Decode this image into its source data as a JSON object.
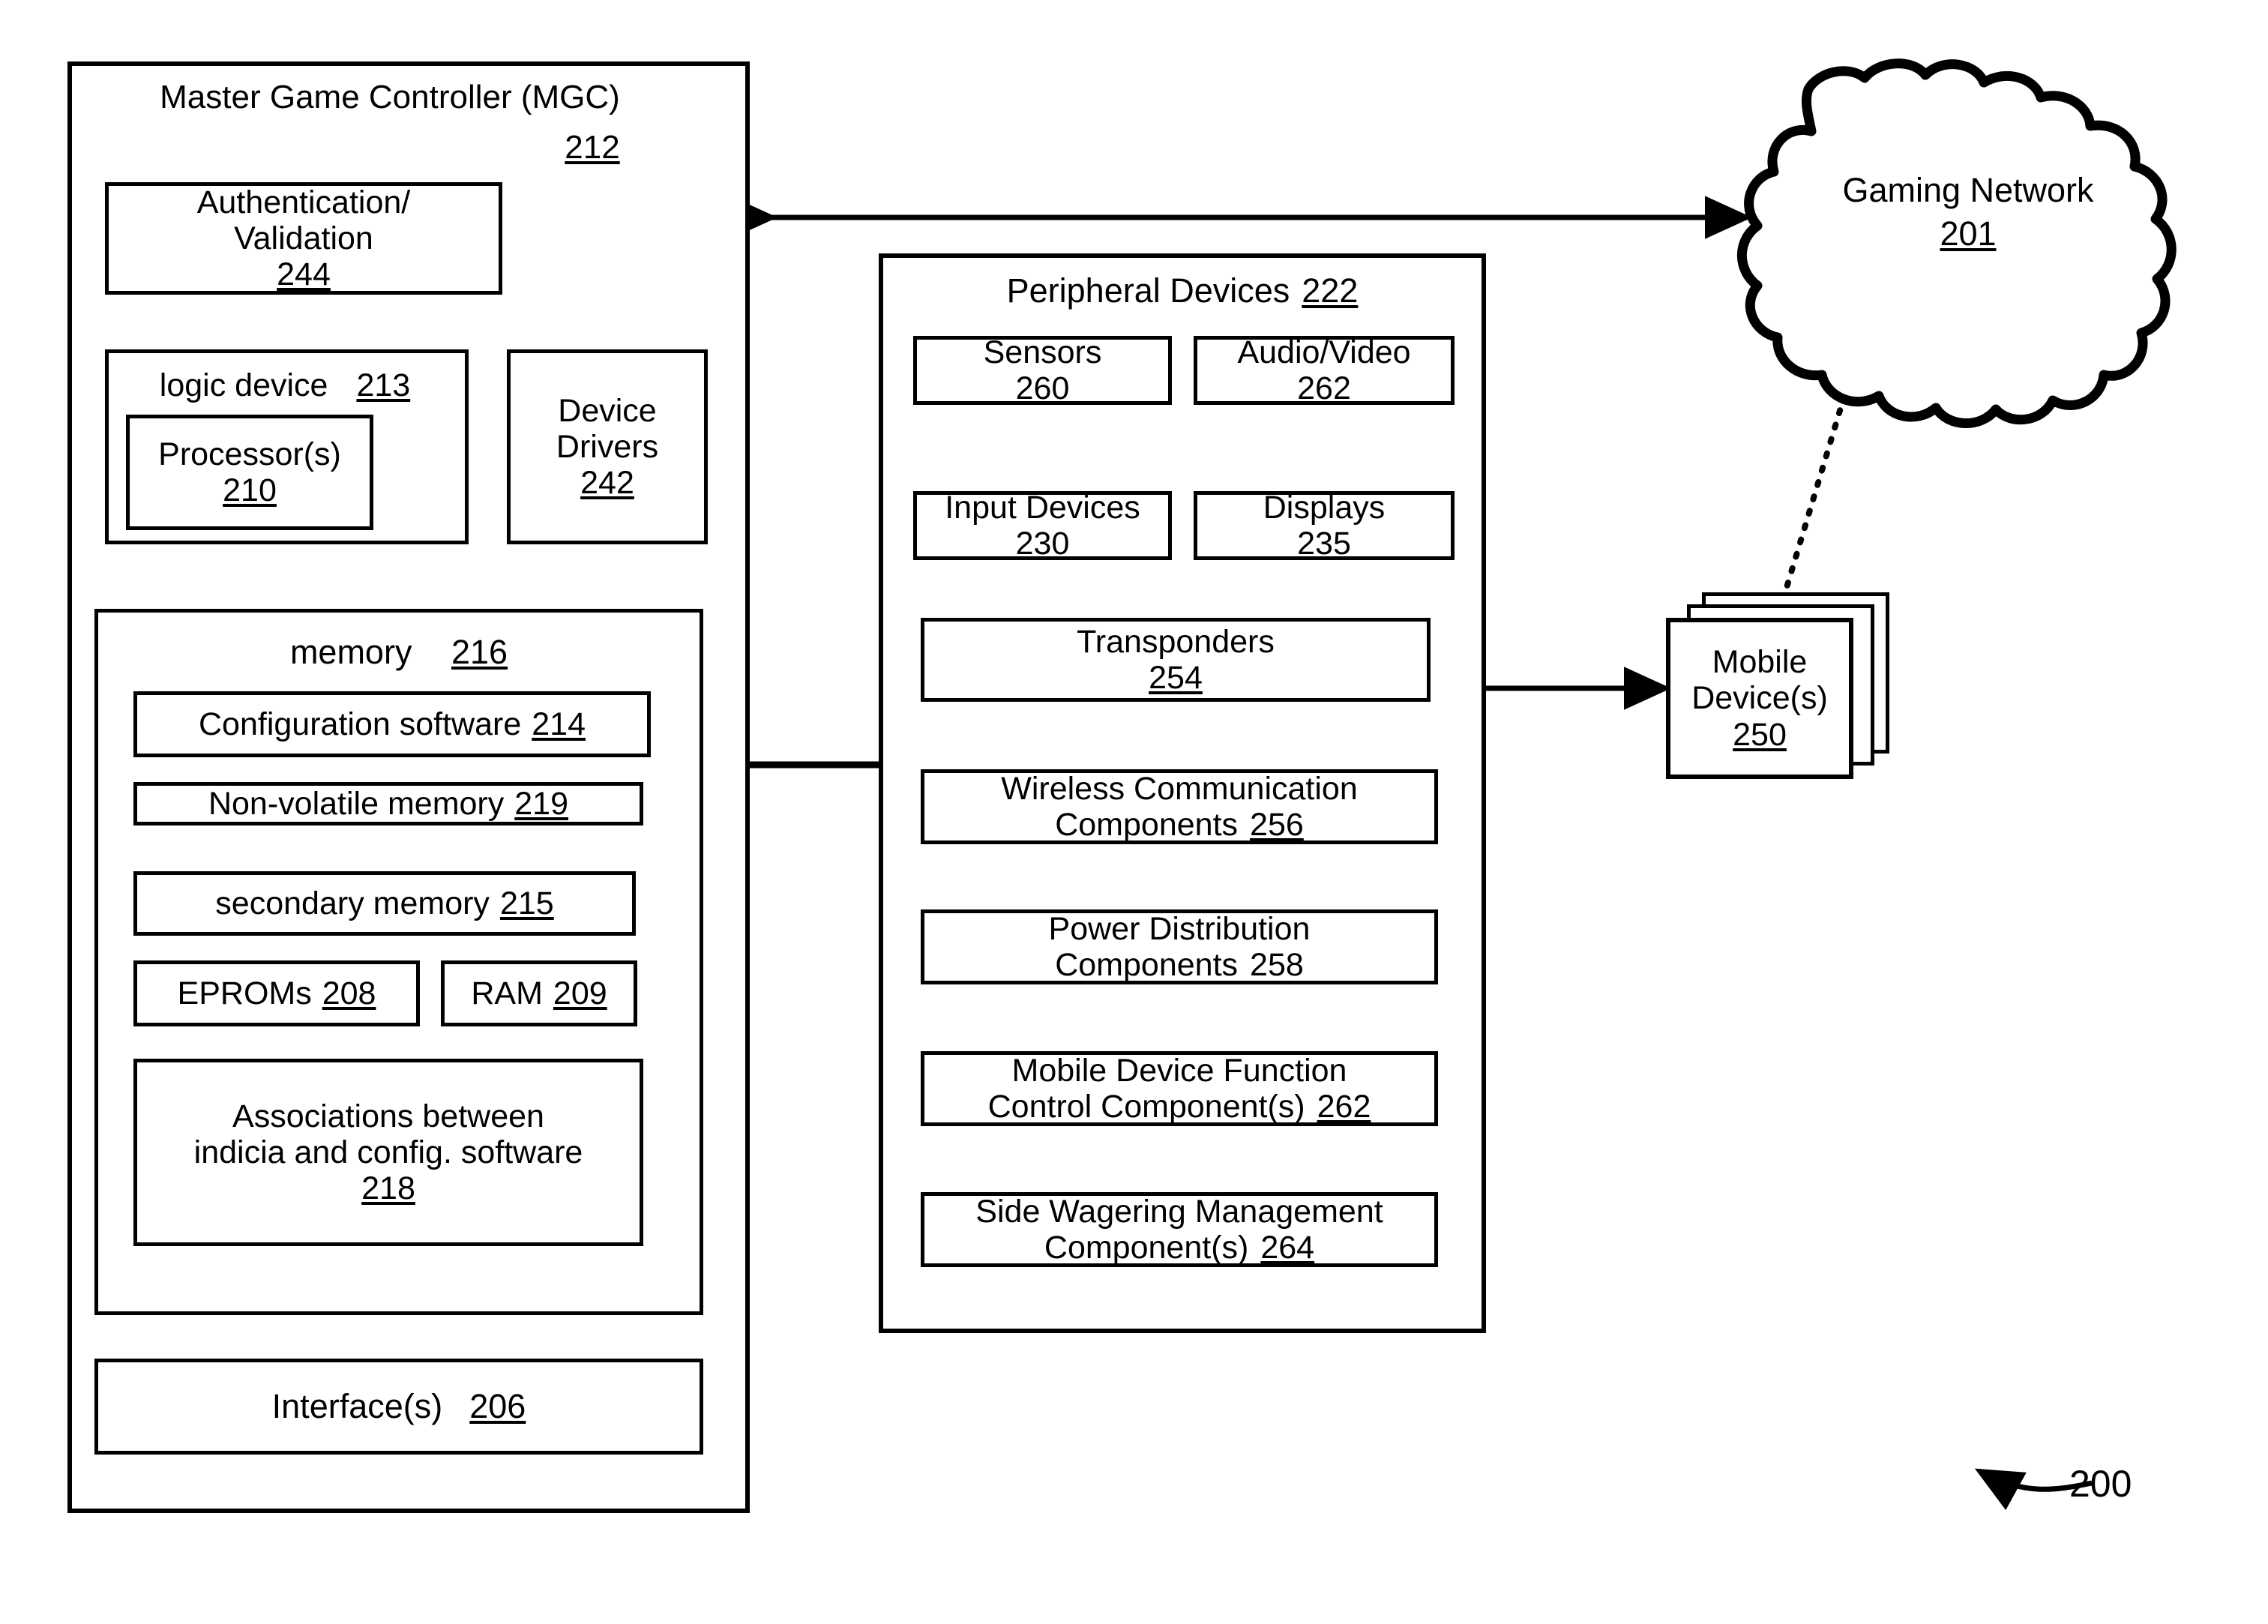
{
  "figure": {
    "number": "200"
  },
  "mgc": {
    "title": "Master Game Controller (MGC)",
    "ref": "212",
    "auth": {
      "line1": "Authentication/",
      "line2": "Validation",
      "ref": "244"
    },
    "logic_device": {
      "label": "logic device",
      "ref": "213"
    },
    "processor": {
      "label": "Processor(s)",
      "ref": "210"
    },
    "device_drivers": {
      "line1": "Device",
      "line2": "Drivers",
      "ref": "242"
    },
    "memory": {
      "label": "memory",
      "ref": "216",
      "items": [
        {
          "label": "Configuration software",
          "ref": "214"
        },
        {
          "label": "Non-volatile memory",
          "ref": "219"
        },
        {
          "label": "secondary memory",
          "ref": "215"
        },
        {
          "label": "EPROMs",
          "ref": "208"
        },
        {
          "label": "RAM",
          "ref": "209"
        }
      ],
      "associations": {
        "line1": "Associations between",
        "line2": "indicia and config. software",
        "ref": "218"
      }
    },
    "interfaces": {
      "label": "Interface(s)",
      "ref": "206"
    }
  },
  "peripherals": {
    "title": "Peripheral Devices",
    "ref": "222",
    "sensors": {
      "label": "Sensors",
      "ref": "260"
    },
    "audio_video": {
      "label": "Audio/Video",
      "ref": "262"
    },
    "input_devices": {
      "label": "Input Devices",
      "ref": "230"
    },
    "displays": {
      "label": "Displays",
      "ref": "235"
    },
    "transponders": {
      "label": "Transponders",
      "ref": "254"
    },
    "wireless": {
      "line1": "Wireless Communication",
      "line2": "Components",
      "ref": "256"
    },
    "power": {
      "line1": "Power Distribution",
      "line2": "Components",
      "ref": "258"
    },
    "mobile_fn": {
      "line1": "Mobile Device Function",
      "line2": "Control Component(s)",
      "ref": "262"
    },
    "side_wager": {
      "line1": "Side Wagering Management",
      "line2": "Component(s)",
      "ref": "264"
    }
  },
  "gaming_network": {
    "label": "Gaming Network",
    "ref": "201"
  },
  "mobile_devices": {
    "line1": "Mobile",
    "line2": "Device(s)",
    "ref": "250"
  }
}
